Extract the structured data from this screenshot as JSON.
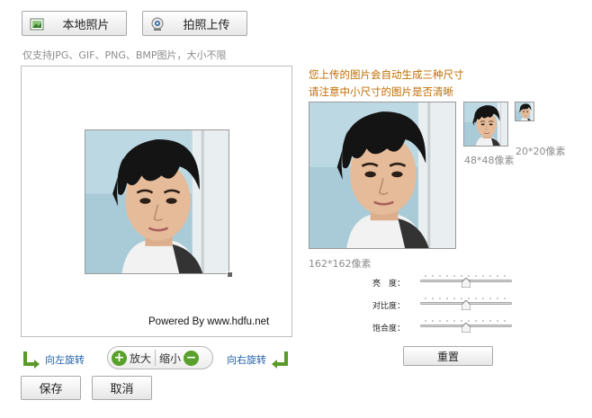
{
  "toolbar": {
    "local_photo_label": "本地照片",
    "camera_upload_label": "拍照上传"
  },
  "hint": "仅支持JPG、GIF、PNG、BMP图片，大小不限",
  "editor": {
    "powered_by": "Powered By www.hdfu.net"
  },
  "controls": {
    "rotate_left_label": "向左旋转",
    "zoom_in_label": "放大",
    "zoom_out_label": "缩小",
    "rotate_right_label": "向右旋转"
  },
  "actions": {
    "save_label": "保存",
    "cancel_label": "取消"
  },
  "preview": {
    "notice_line1": "您上传的图片会自动生成三种尺寸",
    "notice_line2": "请注意中小尺寸的图片是否清晰",
    "large_caption": "162*162像素",
    "medium_caption": "48*48像素",
    "small_caption": "20*20像素"
  },
  "adjust": {
    "brightness_label": "亮　度：",
    "contrast_label": "对比度：",
    "saturation_label": "饱合度：",
    "brightness_value": 0.5,
    "contrast_value": 0.5,
    "saturation_value": 0.5,
    "reset_label": "重置"
  },
  "colors": {
    "notice": "#c06d00",
    "link": "#1f5fa8",
    "accent_green": "#5aa02c"
  }
}
